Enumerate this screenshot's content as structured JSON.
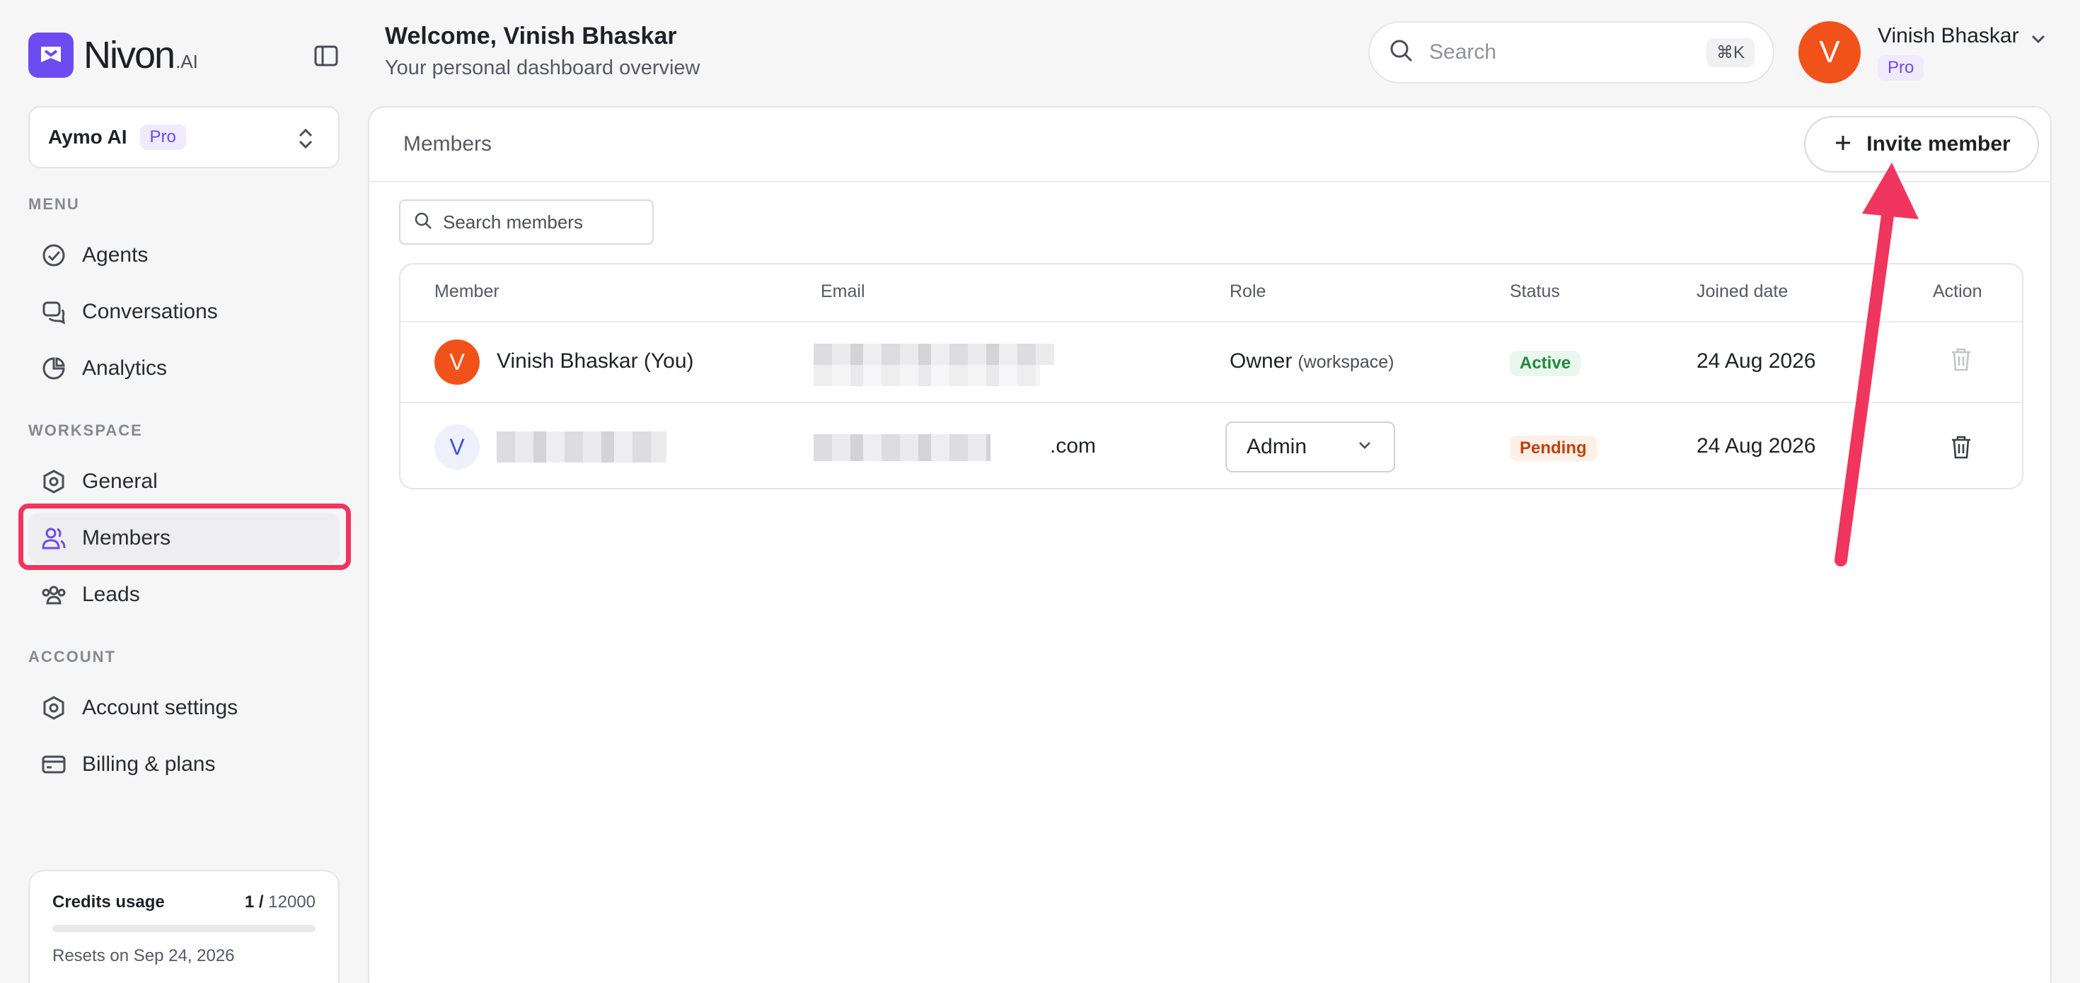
{
  "brand": {
    "name": "Nivon",
    "suffix": ".AI"
  },
  "workspace": {
    "name": "Aymo AI",
    "plan": "Pro"
  },
  "sidebar": {
    "menu_label": "MENU",
    "menu_items": [
      {
        "label": "Agents",
        "icon": "check-circle-icon"
      },
      {
        "label": "Conversations",
        "icon": "chat-icon"
      },
      {
        "label": "Analytics",
        "icon": "pie-chart-icon"
      }
    ],
    "workspace_label": "WORKSPACE",
    "workspace_items": [
      {
        "label": "General",
        "icon": "hexagon-settings-icon"
      },
      {
        "label": "Members",
        "icon": "users-icon",
        "active": true
      },
      {
        "label": "Leads",
        "icon": "user-group-icon"
      }
    ],
    "account_label": "ACCOUNT",
    "account_items": [
      {
        "label": "Account settings",
        "icon": "hexagon-settings-icon"
      },
      {
        "label": "Billing & plans",
        "icon": "credit-card-icon"
      }
    ]
  },
  "credits": {
    "title": "Credits usage",
    "used": "1 /",
    "total": " 12000",
    "fraction": 8.33e-05,
    "reset": "Resets on Sep 24, 2026"
  },
  "header": {
    "welcome": "Welcome, Vinish Bhaskar",
    "subtitle": "Your personal dashboard overview",
    "search_placeholder": "Search",
    "search_shortcut": "⌘K"
  },
  "user": {
    "initial": "V",
    "name": "Vinish Bhaskar",
    "plan": "Pro"
  },
  "members_page": {
    "title": "Members",
    "invite_label": "Invite member",
    "search_placeholder": "Search members",
    "columns": [
      "Member",
      "Email",
      "Role",
      "Status",
      "Joined date",
      "Action"
    ],
    "rows": [
      {
        "initial": "V",
        "name": "Vinish Bhaskar (You)",
        "email": "",
        "role": "Owner",
        "role_note": "(workspace)",
        "status": "Active",
        "joined": "24 Aug 2026"
      },
      {
        "initial": "V",
        "name": "",
        "email": ".com",
        "role": "Admin",
        "status": "Pending",
        "joined": "24 Aug 2026"
      }
    ]
  },
  "colors": {
    "accent": "#6c4cf1",
    "avatar": "#f1521a",
    "highlight": "#f0355e",
    "active_status": "#1f8a3b",
    "pending_status": "#c2410c"
  }
}
